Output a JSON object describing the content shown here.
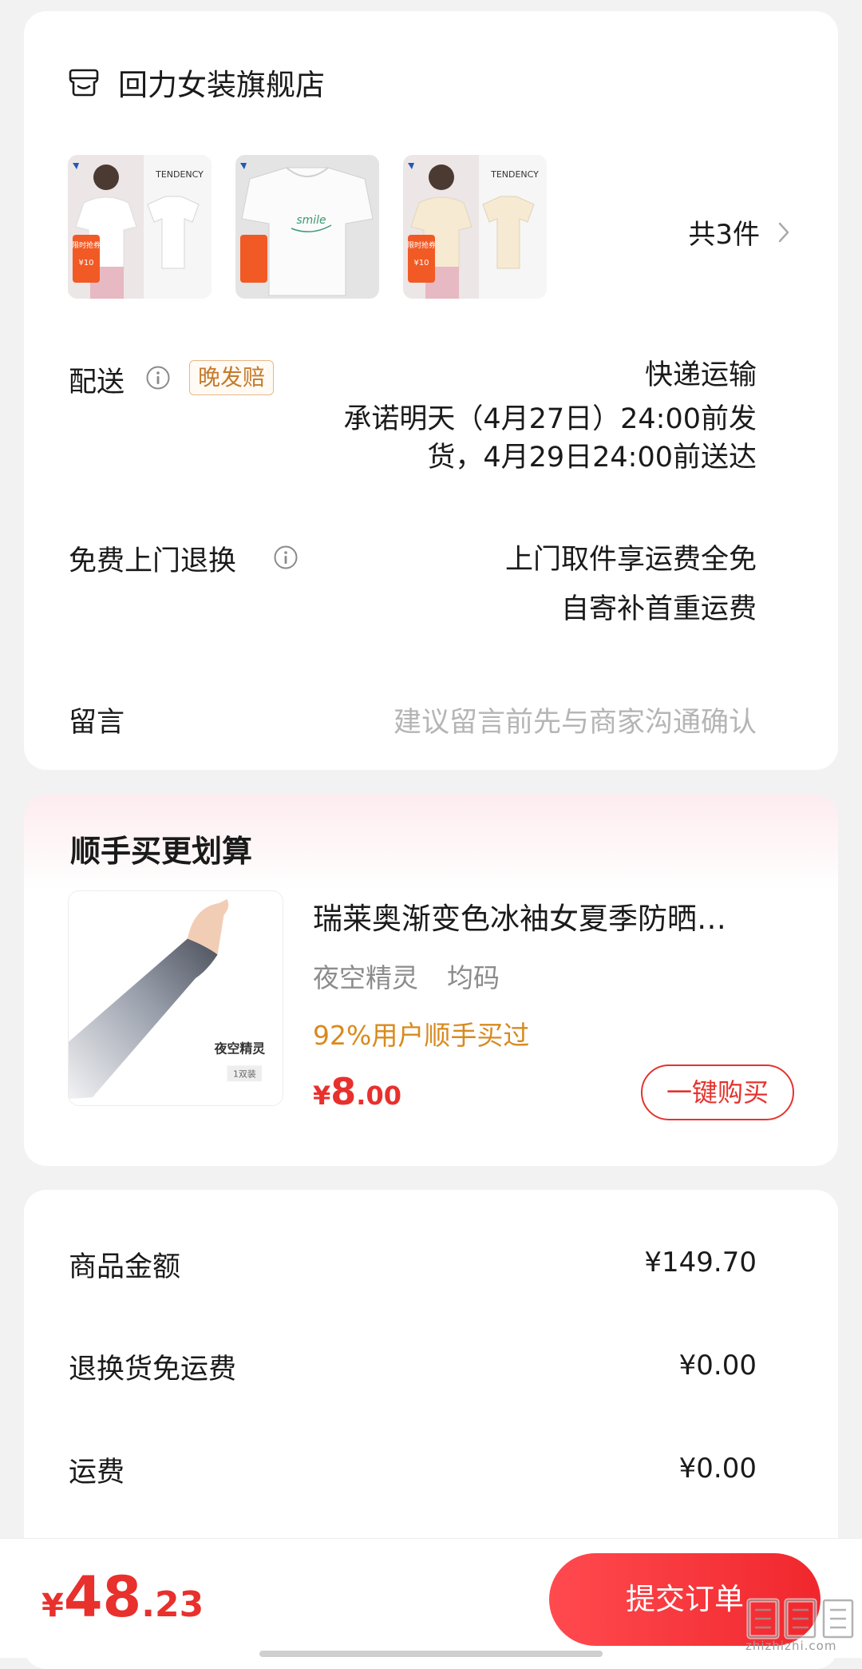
{
  "store": {
    "name": "回力女装旗舰店",
    "item_count": "共3件",
    "thumbnails": [
      {
        "brand_text": "TENDENCY",
        "promo_top": "限时抢券",
        "promo_price": "¥10",
        "shirt_color": "#ffffff"
      },
      {
        "brand_text": "",
        "promo_top": "",
        "promo_price": "",
        "shirt_color": "#ffffff"
      },
      {
        "brand_text": "TENDENCY",
        "promo_top": "限时抢券",
        "promo_price": "¥10",
        "shirt_color": "#f6ead2"
      }
    ]
  },
  "shipping": {
    "label": "配送",
    "badge": "晚发赔",
    "method": "快递运输",
    "promise_line1": "承诺明天（4月27日）24:00前发",
    "promise_line2": "货，4月29日24:00前送达"
  },
  "returns": {
    "label": "免费上门退换",
    "line1": "上门取件享运费全免",
    "line2": "自寄补首重运费"
  },
  "note": {
    "label": "留言",
    "placeholder": "建议留言前先与商家沟通确认"
  },
  "upsell": {
    "title": "顺手买更划算",
    "product_name": "瑞莱奥渐变色冰袖女夏季防晒…",
    "spec_color": "夜空精灵",
    "spec_size": "均码",
    "social_proof": "92%用户顺手买过",
    "price_symbol": "¥",
    "price_int": "8",
    "price_dec": ".00",
    "buy_label": "一键购买",
    "image_caption": "夜空精灵",
    "image_pack": "1双装"
  },
  "amounts": [
    {
      "label": "商品金额",
      "value": "¥149.70"
    },
    {
      "label": "退换货免运费",
      "value": "¥0.00"
    },
    {
      "label": "运费",
      "value": "¥0.00"
    }
  ],
  "footer": {
    "total_symbol": "¥",
    "total_int": "48",
    "total_dec": ".23",
    "submit_label": "提交订单",
    "watermark": "zhizhizhi.com"
  },
  "colors": {
    "accent_red": "#e8302d",
    "badge_orange": "#c57b2b",
    "social_orange": "#d88a1e",
    "placeholder_gray": "#b5b5b5"
  }
}
